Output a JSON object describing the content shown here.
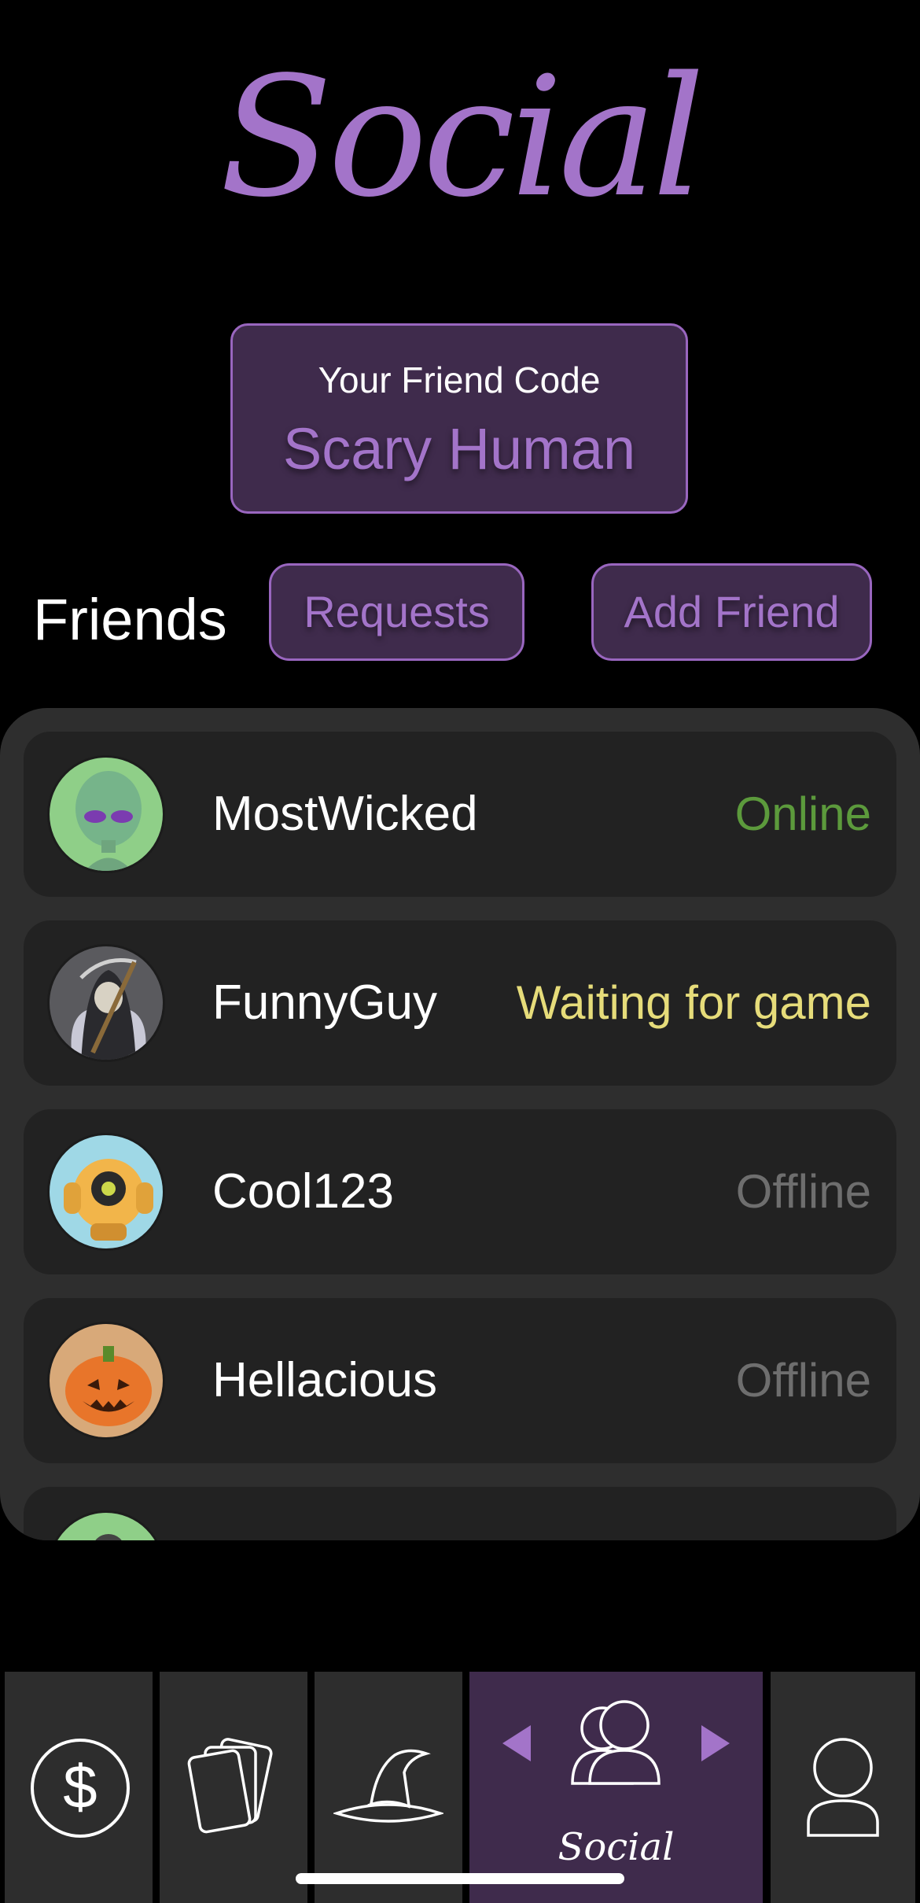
{
  "header": {
    "title": "Social"
  },
  "friend_code": {
    "label": "Your Friend Code",
    "value": "Scary Human"
  },
  "friends": {
    "heading": "Friends",
    "requests_label": "Requests",
    "add_friend_label": "Add Friend",
    "list": [
      {
        "name": "MostWicked",
        "status": "Online",
        "status_color": "#5c9a3c",
        "avatar": "alien-avatar"
      },
      {
        "name": "FunnyGuy",
        "status": "Waiting for game",
        "status_color": "#e6dc7a",
        "avatar": "reaper-avatar"
      },
      {
        "name": "Cool123",
        "status": "Offline",
        "status_color": "#6e6e6e",
        "avatar": "robot-avatar"
      },
      {
        "name": "Hellacious",
        "status": "Offline",
        "status_color": "#6e6e6e",
        "avatar": "pumpkin-avatar"
      }
    ]
  },
  "nav": {
    "tabs": [
      {
        "icon": "dollar-icon"
      },
      {
        "icon": "cards-icon"
      },
      {
        "icon": "witch-hat-icon"
      },
      {
        "icon": "people-icon",
        "label": "Social",
        "active": true
      },
      {
        "icon": "profile-icon"
      }
    ]
  },
  "colors": {
    "accent": "#a374c9",
    "active_tab": "#3f2b4c",
    "panel": "#2e2e2e",
    "row": "#222222"
  }
}
